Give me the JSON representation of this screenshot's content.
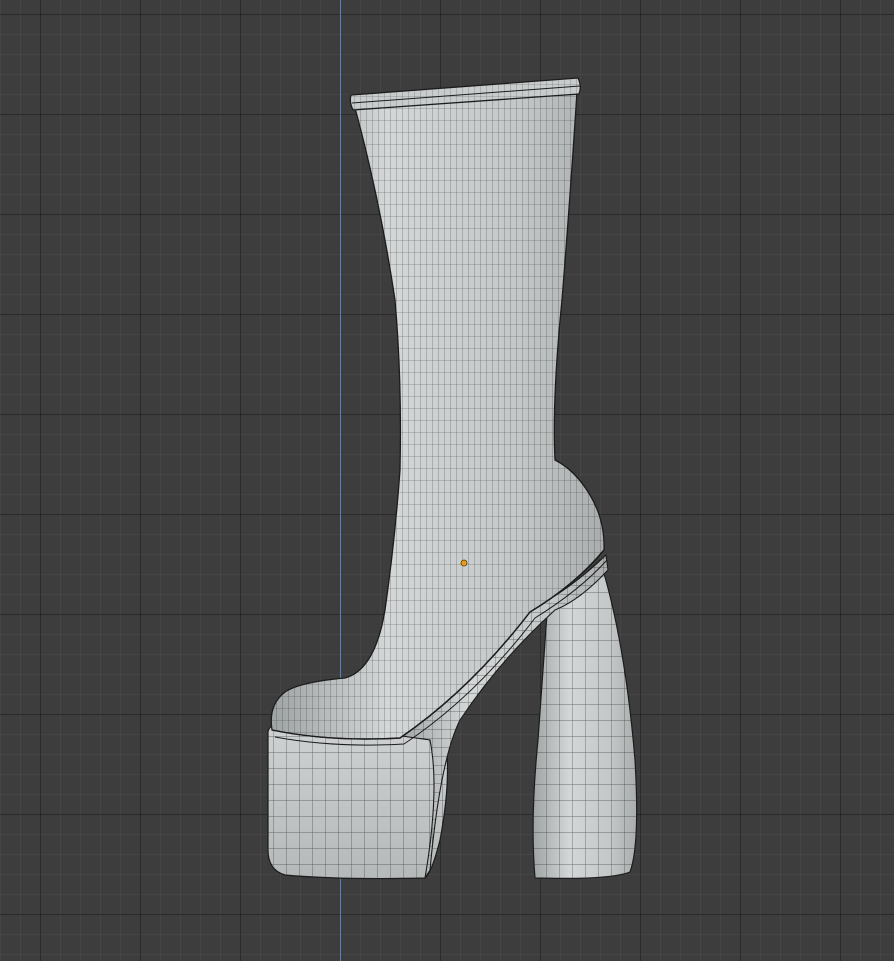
{
  "viewport": {
    "grid_visible": true,
    "vertical_axis": "z-axis",
    "background_color": "#3d3d3d",
    "axis_color": "#5a7fc8",
    "mesh_color": "#c8cccc",
    "wire_color": "#1c1c1c",
    "origin_color": "#e89b1f"
  },
  "object": {
    "description_icon": "mesh-object",
    "display_mode": "solid-with-wireframe",
    "origin_marker": "object-origin-dot"
  }
}
